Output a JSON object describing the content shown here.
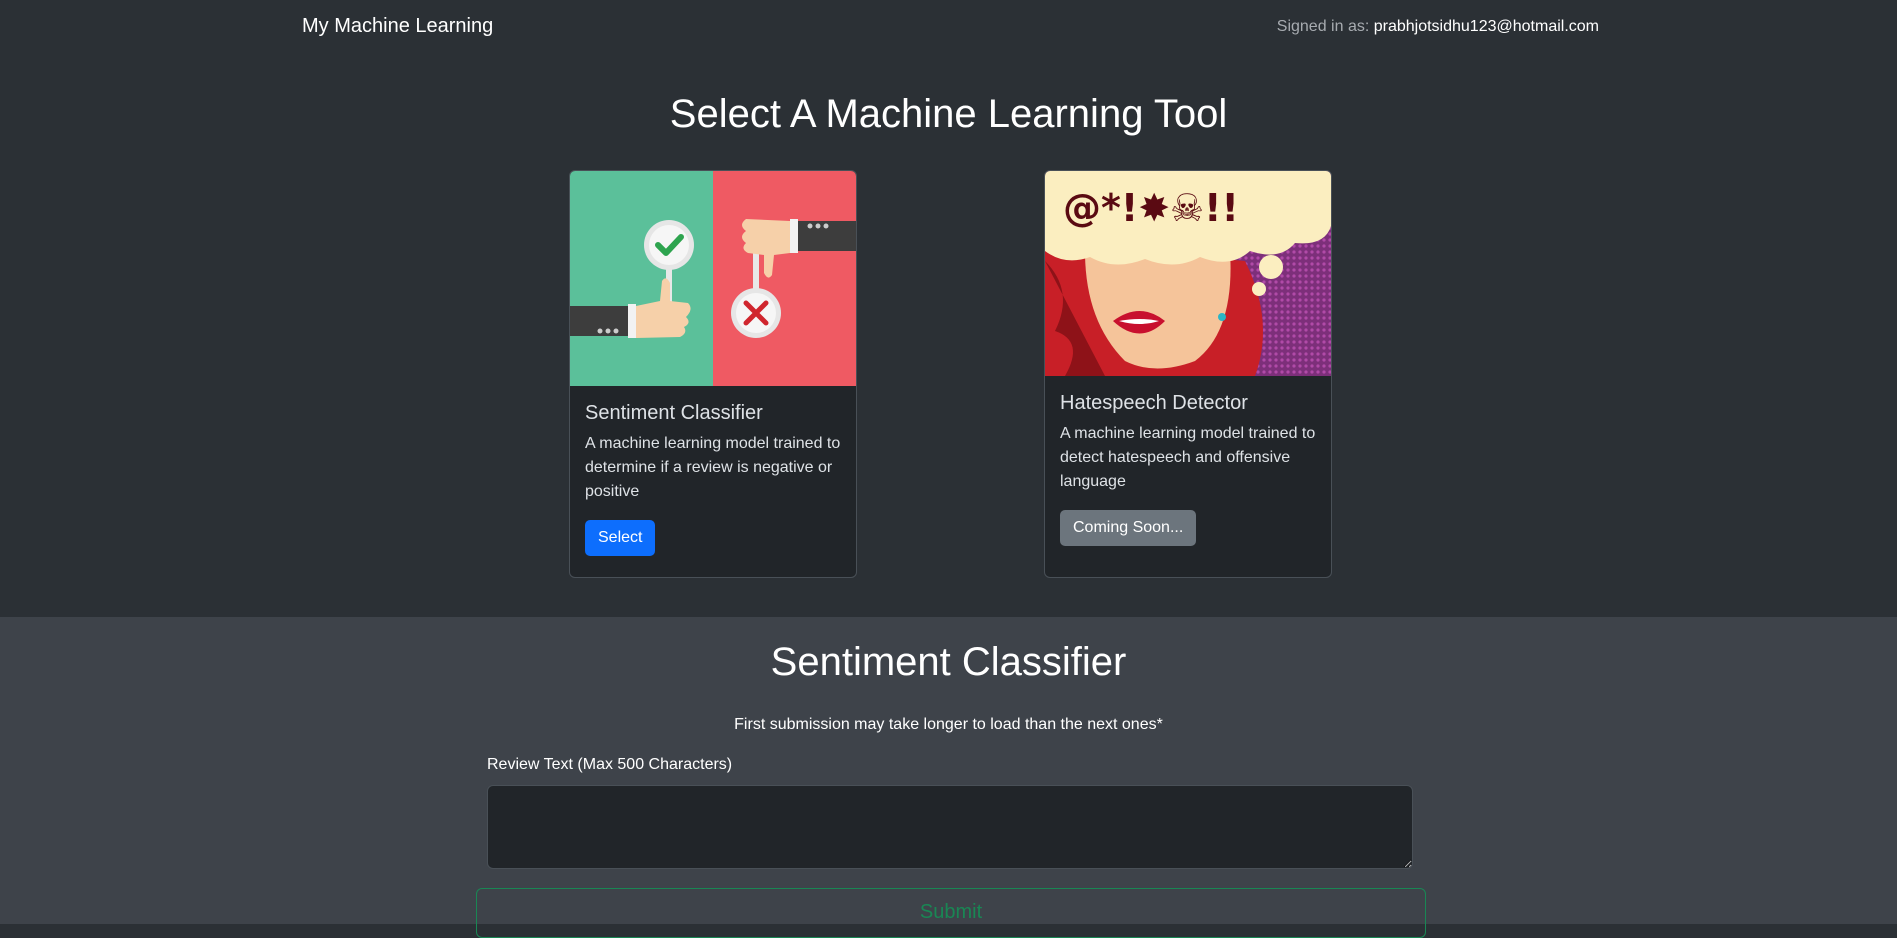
{
  "nav": {
    "brand": "My Machine Learning",
    "signed_in_label": "Signed in as: ",
    "email": "prabhjotsidhu123@hotmail.com"
  },
  "hero": {
    "title": "Select A Machine Learning Tool"
  },
  "cards": [
    {
      "title": "Sentiment Classifier",
      "text": "A machine learning model trained to determine if a review is negative or positive",
      "button": "Select",
      "image_icon": "thumbs-up-down-illustration"
    },
    {
      "title": "Hatespeech Detector",
      "text": "A machine learning model trained to detect hatespeech and offensive language",
      "button": "Coming Soon...",
      "image_icon": "angry-comic-woman-illustration",
      "image_symbols": "@*!✸☠!!"
    }
  ],
  "section": {
    "title": "Sentiment Classifier",
    "note": "First submission may take longer to load than the next ones*",
    "field_label": "Review Text (Max 500 Characters)",
    "field_value": "",
    "submit": "Submit"
  },
  "colors": {
    "page_bg": "#2b3035",
    "section_bg": "#3e434a",
    "card_bg": "#212529",
    "primary": "#0d6efd",
    "secondary": "#6c757d",
    "success": "#198754"
  }
}
